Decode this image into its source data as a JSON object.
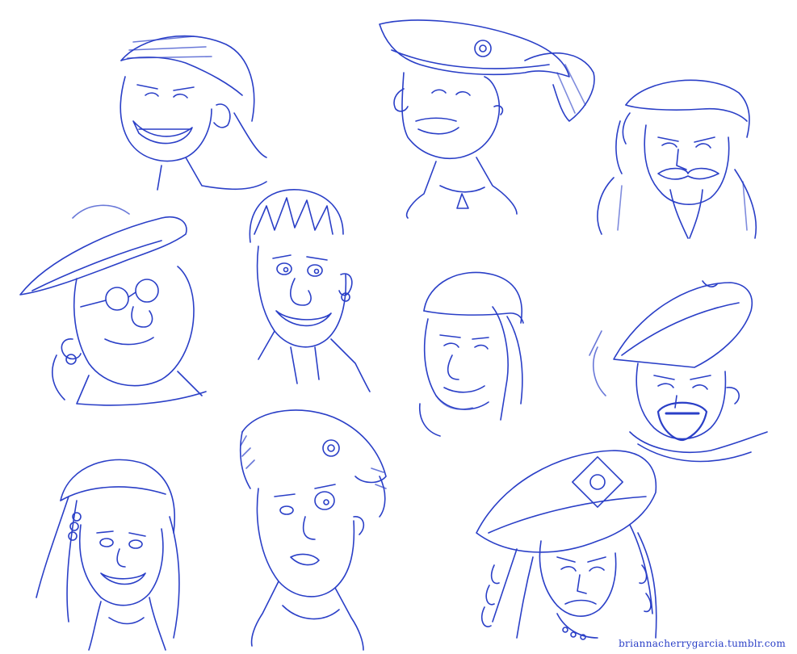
{
  "artwork": {
    "ink_color": "#2a3fc7",
    "paper_color": "#ffffff",
    "credit_text": "briannacherrygarcia.tumblr.com",
    "sketches": [
      {
        "id": "bandana-grin",
        "icon": "pirate-bandana-grin-icon"
      },
      {
        "id": "feather-hat-laugh",
        "icon": "pirate-feather-hat-icon"
      },
      {
        "id": "mustache-bandana",
        "icon": "pirate-mustache-icon"
      },
      {
        "id": "glasses-tricorn",
        "icon": "pirate-glasses-hat-icon"
      },
      {
        "id": "messy-hair-smile",
        "icon": "pirate-messy-hair-icon"
      },
      {
        "id": "headscarf-smirk",
        "icon": "pirate-headscarf-icon"
      },
      {
        "id": "captain-beard",
        "icon": "pirate-captain-beard-icon"
      },
      {
        "id": "girl-headband",
        "icon": "pirate-girl-icon"
      },
      {
        "id": "furry-hat-squint",
        "icon": "pirate-fur-hat-icon"
      },
      {
        "id": "tricorn-curly-hair",
        "icon": "pirate-tricorn-curls-icon"
      }
    ]
  }
}
